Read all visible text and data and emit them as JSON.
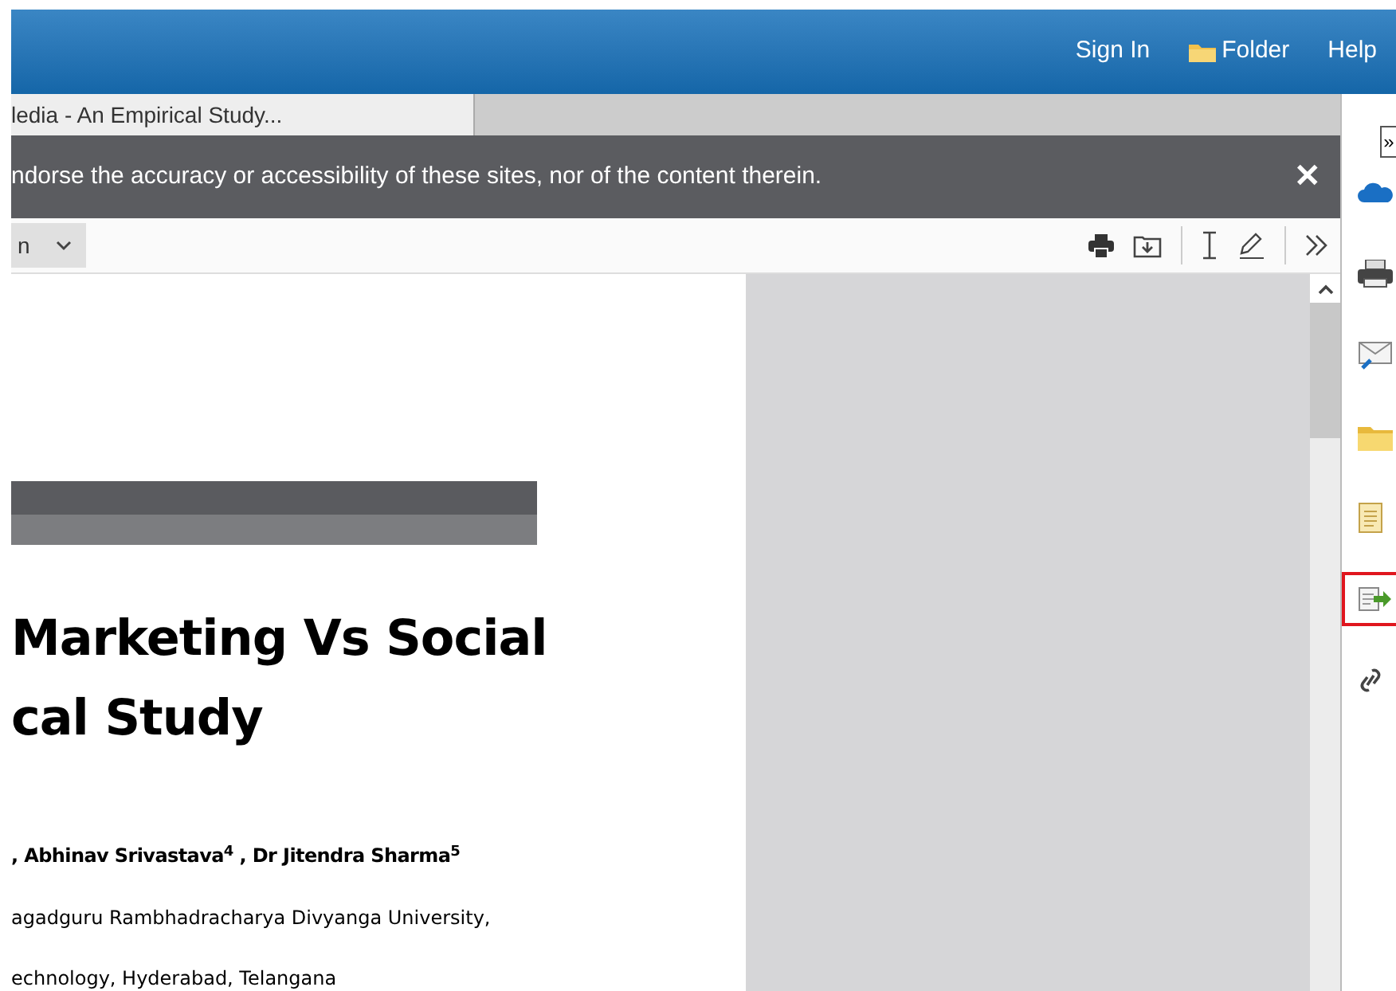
{
  "header": {
    "links": [
      {
        "kind": "text",
        "label": "Sign In"
      },
      {
        "kind": "folder",
        "label": "Folder"
      },
      {
        "kind": "text",
        "label": "Help"
      }
    ]
  },
  "tabs": [
    {
      "label": "ledia - An Empirical Study...",
      "selected": true
    }
  ],
  "notice": {
    "text": "ndorse the accuracy or accessibility of these sites, nor of the content therein.",
    "close": "✕"
  },
  "toolbar": {
    "zoom": "n",
    "tools": [
      {
        "kind": "print"
      },
      {
        "kind": "download"
      },
      {
        "kind": "sep"
      },
      {
        "kind": "text-select"
      },
      {
        "kind": "pen"
      },
      {
        "kind": "sep"
      },
      {
        "kind": "more"
      }
    ]
  },
  "document": {
    "title_lines": [
      "Marketing Vs Social",
      "cal Study"
    ],
    "authors": ", Abhinav Srivastava$^{4}$ , Dr Jitendra Sharma$^{5}$",
    "affiliations": [
      "agadguru Rambhadracharya Divyanga University,",
      "echnology, Hyderabad, Telangana"
    ]
  },
  "sidebar": {
    "toggle": "»",
    "tools": [
      {
        "kind": "cloud",
        "selected": false
      },
      {
        "kind": "printer",
        "selected": false
      },
      {
        "kind": "mail",
        "selected": false
      },
      {
        "kind": "folder",
        "selected": false
      },
      {
        "kind": "document",
        "selected": false
      },
      {
        "kind": "export",
        "selected": true
      },
      {
        "kind": "link",
        "selected": false
      }
    ]
  }
}
